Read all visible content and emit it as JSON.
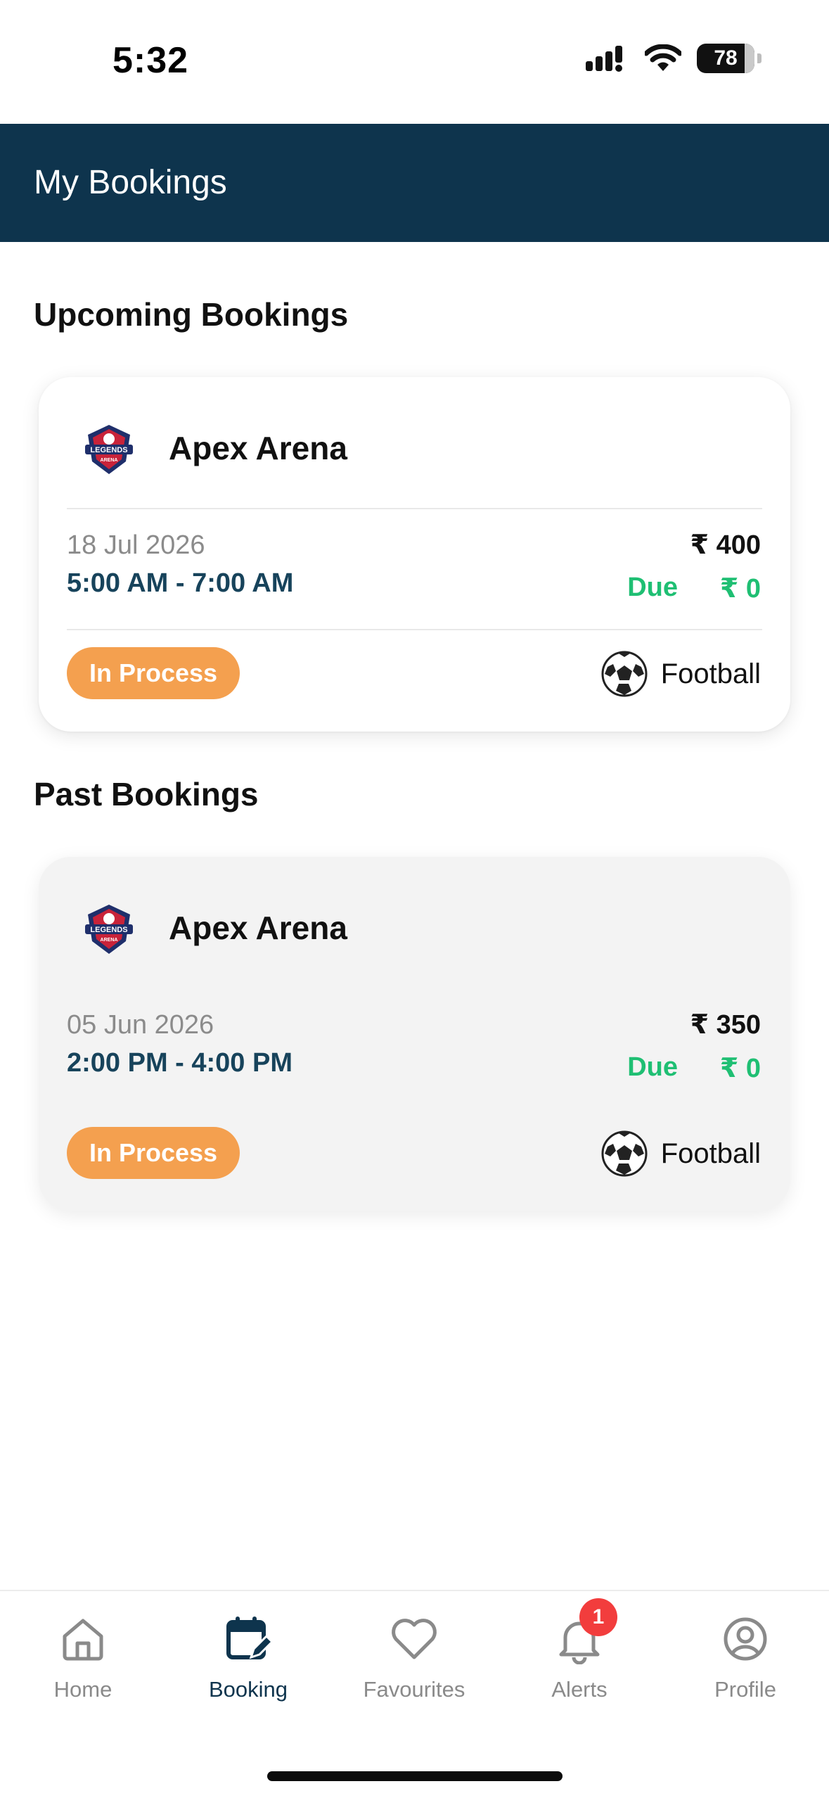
{
  "status_bar": {
    "time": "5:32",
    "battery": "78"
  },
  "header": {
    "title": "My Bookings"
  },
  "sections": {
    "upcoming_title": "Upcoming Bookings",
    "past_title": "Past Bookings"
  },
  "upcoming_booking": {
    "venue": "Apex Arena",
    "date": "18 Jul 2026",
    "time": "5:00 AM - 7:00 AM",
    "price": "₹ 400",
    "due_label": "Due",
    "due_amount": "₹ 0",
    "status": "In Process",
    "sport": "Football"
  },
  "past_booking": {
    "venue": "Apex Arena",
    "date": "05 Jun 2026",
    "time": "2:00 PM - 4:00 PM",
    "price": "₹ 350",
    "due_label": "Due",
    "due_amount": "₹ 0",
    "status": "In Process",
    "sport": "Football"
  },
  "bottom_nav": {
    "items": [
      {
        "label": "Home",
        "icon": "home-icon"
      },
      {
        "label": "Booking",
        "icon": "calendar-edit-icon",
        "active": true
      },
      {
        "label": "Favourites",
        "icon": "heart-icon"
      },
      {
        "label": "Alerts",
        "icon": "bell-icon",
        "badge": "1"
      },
      {
        "label": "Profile",
        "icon": "user-circle-icon"
      }
    ]
  },
  "colors": {
    "header_bg": "#0e344d",
    "due_green": "#1fbf73",
    "status_orange": "#f4a04f",
    "badge_red": "#f23d3d"
  }
}
